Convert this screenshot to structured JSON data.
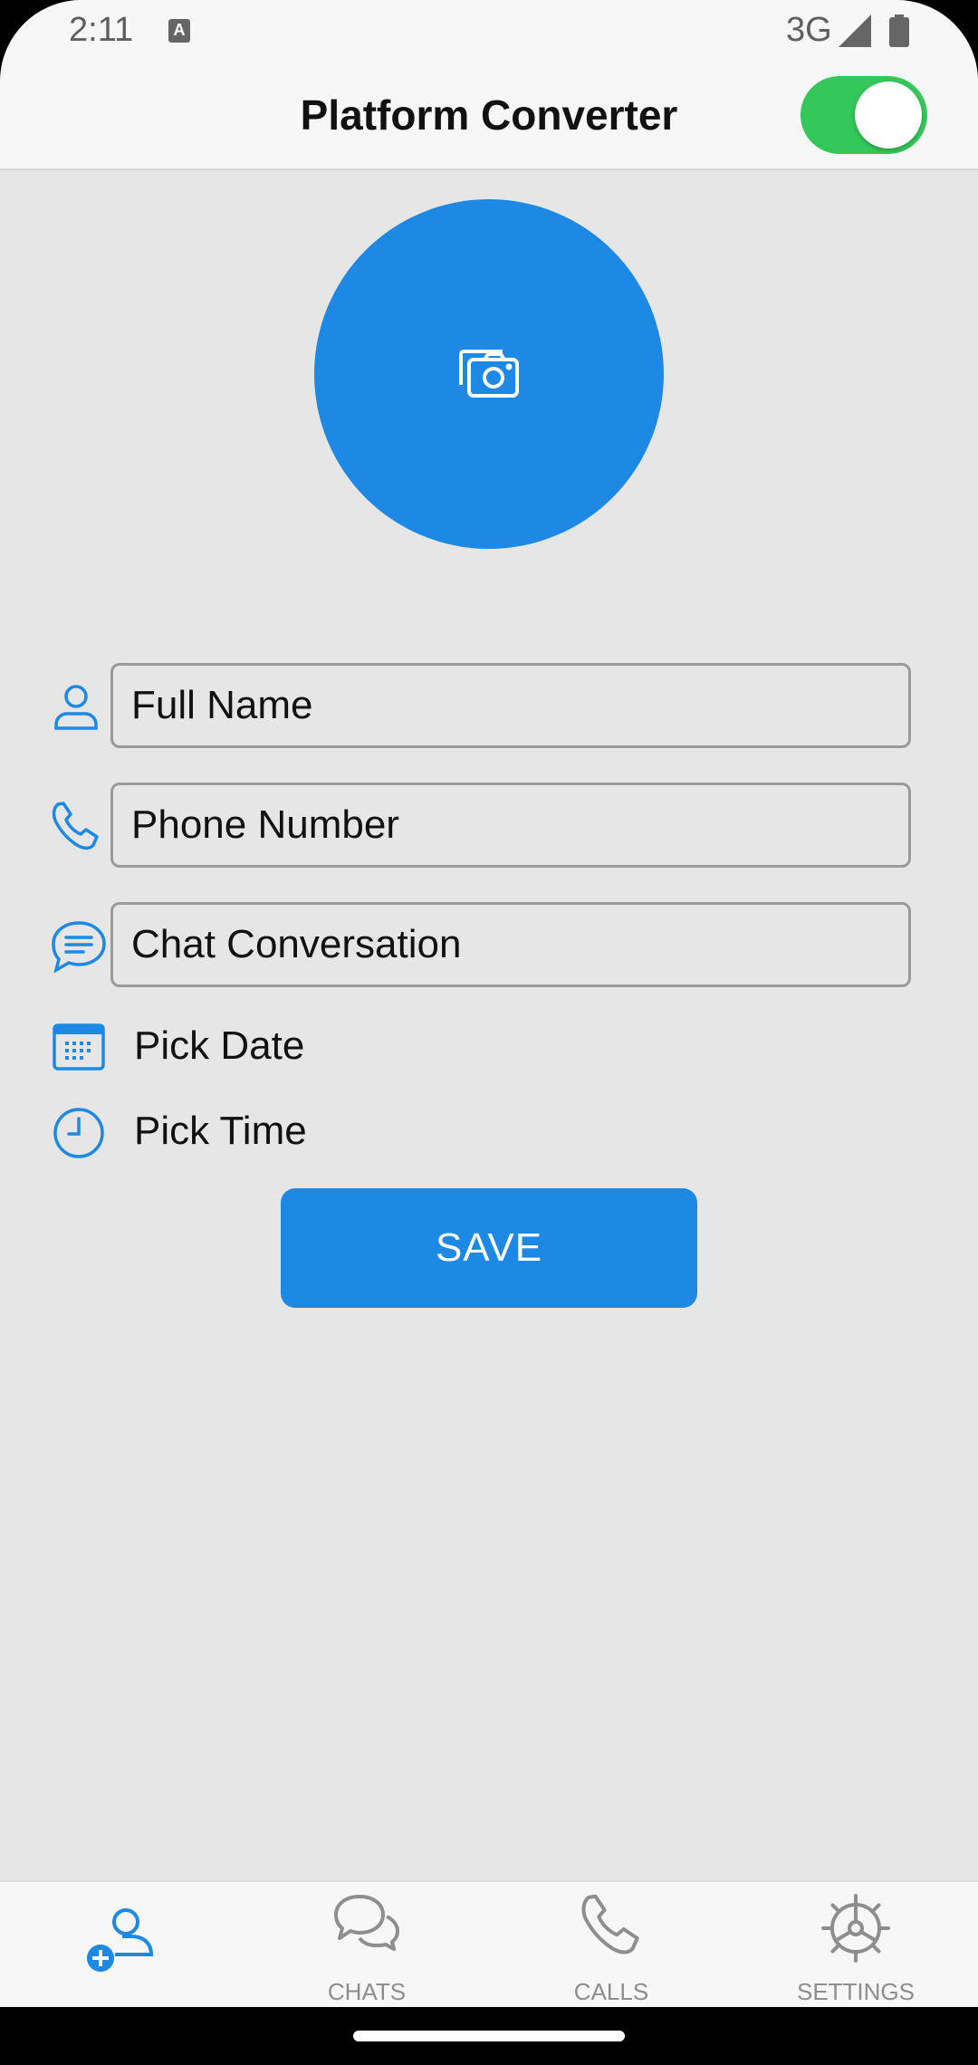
{
  "status_bar": {
    "time": "2:11",
    "network": "3G",
    "keyboard_badge": "A"
  },
  "header": {
    "title": "Platform Converter",
    "toggle_on": true
  },
  "form": {
    "full_name_placeholder": "Full Name",
    "phone_placeholder": "Phone Number",
    "chat_placeholder": "Chat Conversation",
    "pick_date": "Pick Date",
    "pick_time": "Pick Time",
    "save_label": "SAVE"
  },
  "nav": {
    "items": [
      {
        "label": "",
        "icon": "add-user-icon",
        "active": true
      },
      {
        "label": "CHATS",
        "icon": "chat-bubbles-icon"
      },
      {
        "label": "CALLS",
        "icon": "phone-icon"
      },
      {
        "label": "SETTINGS",
        "icon": "gear-icon"
      }
    ]
  },
  "colors": {
    "accent": "#1e88e5",
    "toggle": "#34c759",
    "background": "#e6e6e6",
    "bar": "#f7f7f7"
  }
}
